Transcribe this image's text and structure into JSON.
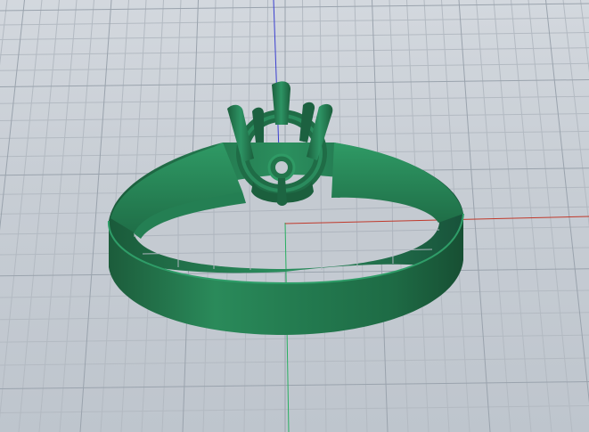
{
  "viewport": {
    "label": "",
    "background": "#c8ced5",
    "grid": true,
    "grid_minor_color": "#b3bac2",
    "grid_major_color": "#9aa3ad",
    "axis_x_color": "#c0392b",
    "axis_y_color": "#27ae60",
    "axis_z_color": "#3a3fd0"
  },
  "model": {
    "name": "solitaire-ring",
    "color": "#1f6b45"
  }
}
